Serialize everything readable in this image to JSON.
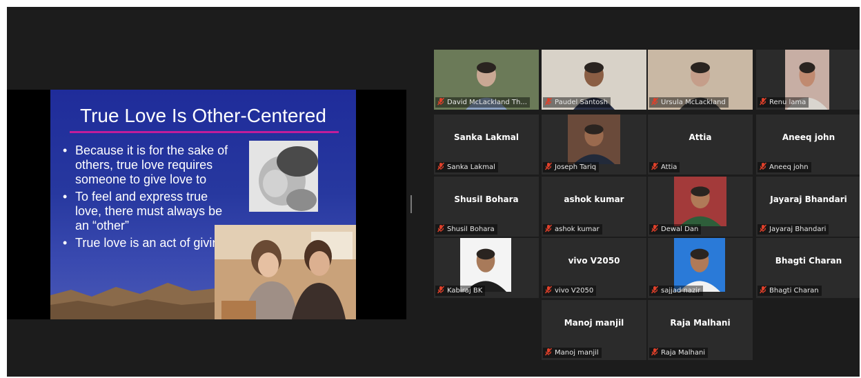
{
  "slide": {
    "title": "True Love Is Other-Centered",
    "bullets": [
      "Because it is for the sake of others, true love requires someone to give love to",
      "To feel and express true love, there must always be an “other”",
      "True love is an act of giving"
    ]
  },
  "participants": [
    {
      "display": "",
      "label": "David McLackland Th...",
      "video": true
    },
    {
      "display": "",
      "label": "Paudel Santosh",
      "video": true
    },
    {
      "display": "",
      "label": "Ursula McLackland",
      "video": true,
      "active_speaker": true
    },
    {
      "display": "",
      "label": "Renu lama",
      "video": true
    },
    {
      "display": "Sanka Lakmal",
      "label": "Sanka Lakmal",
      "video": false
    },
    {
      "display": "",
      "label": "Joseph Tariq",
      "video": true
    },
    {
      "display": "Attia",
      "label": "Attia",
      "video": false
    },
    {
      "display": "Aneeq john",
      "label": "Aneeq john",
      "video": false
    },
    {
      "display": "Shusil Bohara",
      "label": "Shusil Bohara",
      "video": false
    },
    {
      "display": "ashok kumar",
      "label": "ashok kumar",
      "video": false
    },
    {
      "display": "",
      "label": "Dewal Dan",
      "video": true
    },
    {
      "display": "Jayaraj Bhandari",
      "label": "Jayaraj Bhandari",
      "video": false
    },
    {
      "display": "",
      "label": "Kabiraj BK",
      "video": true
    },
    {
      "display": "vivo V2050",
      "label": "vivo V2050",
      "video": false
    },
    {
      "display": "",
      "label": "sajjad nazir",
      "video": true
    },
    {
      "display": "Bhagti Charan",
      "label": "Bhagti Charan",
      "video": false
    },
    {
      "display": "Manoj manjil",
      "label": "Manoj manjil",
      "video": false
    },
    {
      "display": "Raja Malhani",
      "label": "Raja Malhani",
      "video": false
    }
  ],
  "colors": {
    "background": "#1c1c1c",
    "tile": "#2b2b2b",
    "active_speaker_border": "#c8e04a",
    "muted_icon": "#e0402a",
    "slide_rule": "#c21d9a"
  },
  "icons": {
    "muted": "microphone-muted-icon"
  }
}
